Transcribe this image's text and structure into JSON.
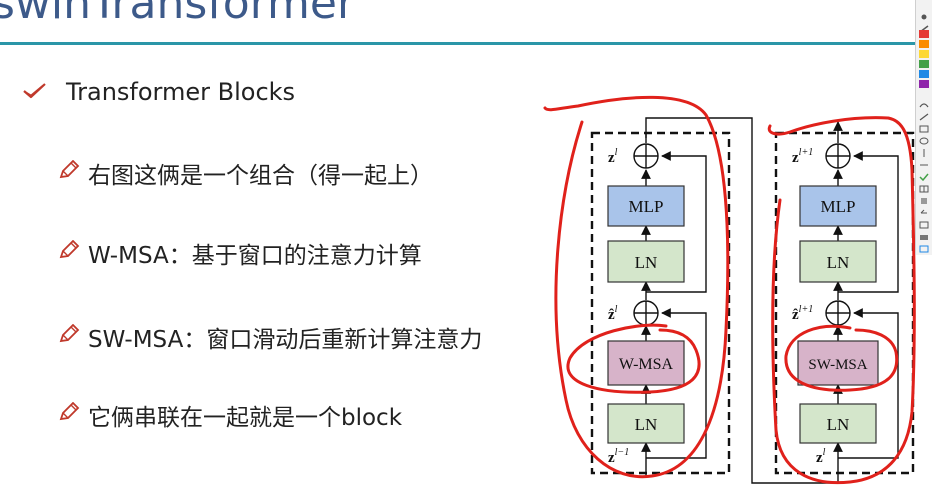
{
  "slide": {
    "title": "swinTransformer"
  },
  "bullets": [
    {
      "icon": "check-icon",
      "text": "Transformer Blocks"
    },
    {
      "icon": "pencil-icon",
      "text": "右图这俩是一个组合（得一起上）"
    },
    {
      "icon": "pencil-icon",
      "text": "W-MSA：基于窗口的注意力计算"
    },
    {
      "icon": "pencil-icon",
      "text": "SW-MSA：窗口滑动后重新计算注意力"
    },
    {
      "icon": "pencil-icon",
      "text": "它俩串联在一起就是一个block"
    }
  ],
  "diagram": {
    "left_block": {
      "mlp": "MLP",
      "ln_top": "LN",
      "attn": "W-MSA",
      "ln_bottom": "LN",
      "input": "z",
      "input_sup": "l−1",
      "mid": "ẑ",
      "mid_sup": "l",
      "output": "z",
      "output_sup": "l"
    },
    "right_block": {
      "mlp": "MLP",
      "ln_top": "LN",
      "attn": "SW-MSA",
      "ln_bottom": "LN",
      "input": "z",
      "input_sup": "l",
      "mid": "ẑ",
      "mid_sup": "l+1",
      "output": "z",
      "output_sup": "l+1"
    },
    "colors": {
      "mlp": "#a9c4ea",
      "ln": "#d4e6cb",
      "attn": "#d7b3c9",
      "annotation": "#e0211b",
      "title": "#3d5a8a",
      "rule": "#2a96a8"
    }
  },
  "toolbar": {
    "tools": [
      "pointer-tool",
      "pen-tool",
      "color-red",
      "color-orange",
      "color-yellow",
      "color-green",
      "color-blue",
      "color-purple",
      "line-tool",
      "rect-tool",
      "ellipse-tool",
      "arrow-tool",
      "text-tool",
      "eraser-tool",
      "undo-tool",
      "save-tool",
      "print-tool",
      "screen-tool"
    ]
  }
}
